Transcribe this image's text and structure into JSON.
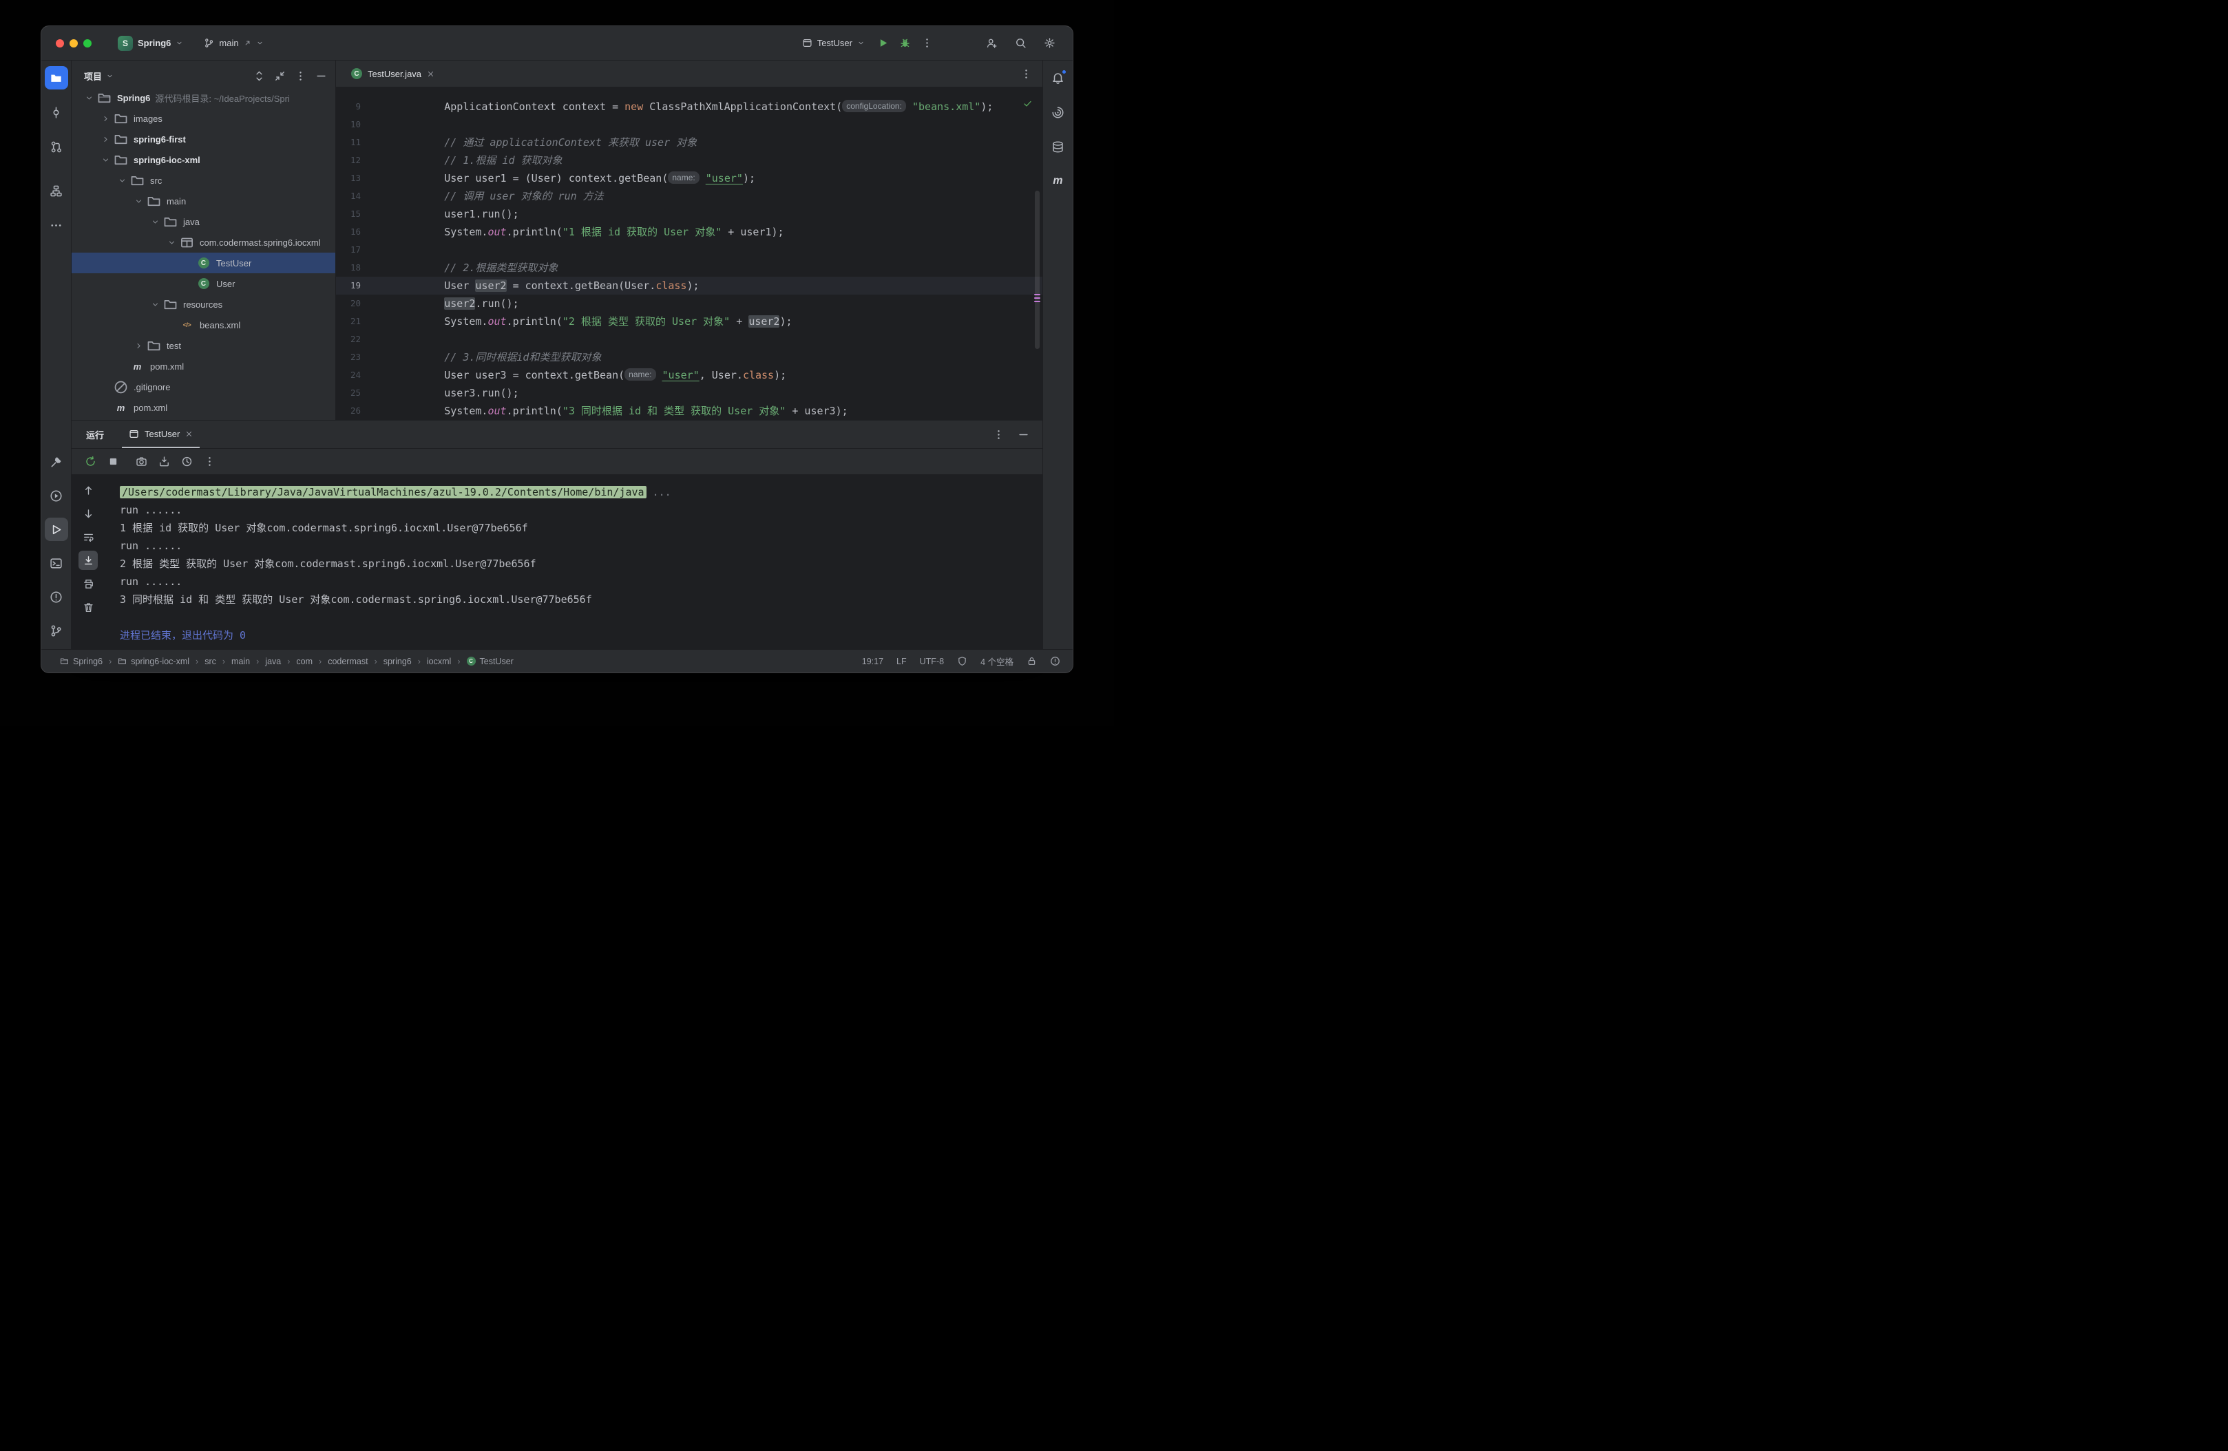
{
  "titlebar": {
    "project_initial": "S",
    "project_name": "Spring6",
    "branch": "main",
    "run_config": "TestUser",
    "run_actions": [
      {
        "icon": "run",
        "tint": "green"
      },
      {
        "icon": "debug",
        "tint": "green"
      },
      {
        "icon": "more-vertical"
      }
    ],
    "right_actions": [
      {
        "icon": "add-user"
      },
      {
        "icon": "search"
      },
      {
        "icon": "settings"
      }
    ]
  },
  "left_stripe": {
    "top": [
      {
        "icon": "project",
        "active": "blue"
      },
      {
        "icon": "commit"
      },
      {
        "icon": "pull-requests"
      },
      {
        "icon": "structure"
      },
      {
        "icon": "more-horizontal"
      }
    ],
    "bottom": [
      {
        "icon": "build"
      },
      {
        "icon": "services"
      },
      {
        "icon": "run-window",
        "active": "gray"
      },
      {
        "icon": "terminal"
      },
      {
        "icon": "problems"
      },
      {
        "icon": "git-branch"
      }
    ]
  },
  "right_stripe": {
    "top": [
      {
        "icon": "notifications",
        "badge": true
      },
      {
        "icon": "ai-assistant"
      },
      {
        "icon": "database"
      },
      {
        "icon": "maven"
      }
    ]
  },
  "project_panel": {
    "title": "项目",
    "header_icons": [
      {
        "icon": "unfold"
      },
      {
        "icon": "collapse-all"
      },
      {
        "icon": "more-vertical"
      },
      {
        "icon": "hide"
      }
    ],
    "tree": [
      {
        "indent": 0,
        "chevron": "expanded",
        "icon": "module",
        "label": "Spring6",
        "hint": "源代码根目录: ~/IdeaProjects/Spri",
        "bold": true
      },
      {
        "indent": 1,
        "chevron": "collapsed",
        "icon": "folder",
        "label": "images"
      },
      {
        "indent": 1,
        "chevron": "collapsed",
        "icon": "folder",
        "label": "spring6-first",
        "bold": true
      },
      {
        "indent": 1,
        "chevron": "expanded",
        "icon": "folder",
        "label": "spring6-ioc-xml",
        "bold": true
      },
      {
        "indent": 2,
        "chevron": "expanded",
        "icon": "folder",
        "label": "src"
      },
      {
        "indent": 3,
        "chevron": "expanded",
        "icon": "folder",
        "label": "main"
      },
      {
        "indent": 4,
        "chevron": "expanded",
        "icon": "folder",
        "label": "java"
      },
      {
        "indent": 5,
        "chevron": "expanded",
        "icon": "package",
        "label": "com.codermast.spring6.iocxml"
      },
      {
        "indent": 6,
        "chevron": null,
        "icon": "class",
        "label": "TestUser",
        "selected": true
      },
      {
        "indent": 6,
        "chevron": null,
        "icon": "class",
        "label": "User"
      },
      {
        "indent": 4,
        "chevron": "expanded",
        "icon": "folder",
        "label": "resources"
      },
      {
        "indent": 5,
        "chevron": null,
        "icon": "xml",
        "label": "beans.xml"
      },
      {
        "indent": 3,
        "chevron": "collapsed",
        "icon": "folder",
        "label": "test"
      },
      {
        "indent": 2,
        "chevron": null,
        "icon": "maven",
        "label": "pom.xml"
      },
      {
        "indent": 1,
        "chevron": null,
        "icon": "gitignore",
        "label": ".gitignore"
      },
      {
        "indent": 1,
        "chevron": null,
        "icon": "maven",
        "label": "pom.xml"
      }
    ]
  },
  "editor": {
    "tab": "TestUser.java",
    "lines": [
      {
        "num": 9,
        "segs": [
          {
            "t": "        ApplicationContext context = ",
            "c": "def"
          },
          {
            "t": "new",
            "c": "kw"
          },
          {
            "t": " ClassPathXmlApplicationContext(",
            "c": "def"
          },
          {
            "t": "configLocation:",
            "c": "hint"
          },
          {
            "t": " ",
            "c": "def"
          },
          {
            "t": "\"beans.xml\"",
            "c": "str"
          },
          {
            "t": ");",
            "c": "def"
          }
        ]
      },
      {
        "num": 10,
        "segs": []
      },
      {
        "num": 11,
        "segs": [
          {
            "t": "        ",
            "c": "def"
          },
          {
            "t": "// 通过 applicationContext 来获取 user 对象",
            "c": "cmt"
          }
        ]
      },
      {
        "num": 12,
        "segs": [
          {
            "t": "        ",
            "c": "def"
          },
          {
            "t": "// 1.根据 id 获取对象",
            "c": "cmt"
          }
        ]
      },
      {
        "num": 13,
        "segs": [
          {
            "t": "        User user1 = (User) context.getBean(",
            "c": "def"
          },
          {
            "t": "name:",
            "c": "hint"
          },
          {
            "t": " ",
            "c": "def"
          },
          {
            "t": "\"user\"",
            "c": "strref"
          },
          {
            "t": ");",
            "c": "def"
          }
        ]
      },
      {
        "num": 14,
        "segs": [
          {
            "t": "        ",
            "c": "def"
          },
          {
            "t": "// 调用 user 对象的 run 方法",
            "c": "cmt"
          }
        ]
      },
      {
        "num": 15,
        "segs": [
          {
            "t": "        user1.run();",
            "c": "def"
          }
        ]
      },
      {
        "num": 16,
        "segs": [
          {
            "t": "        System.",
            "c": "def"
          },
          {
            "t": "out",
            "c": "field"
          },
          {
            "t": ".println(",
            "c": "def"
          },
          {
            "t": "\"1 根据 id 获取的 User 对象\"",
            "c": "str"
          },
          {
            "t": " + user1);",
            "c": "def"
          }
        ]
      },
      {
        "num": 17,
        "segs": []
      },
      {
        "num": 18,
        "segs": [
          {
            "t": "        ",
            "c": "def"
          },
          {
            "t": "// 2.根据类型获取对象",
            "c": "cmt"
          }
        ]
      },
      {
        "num": 19,
        "current": true,
        "segs": [
          {
            "t": "        User ",
            "c": "def"
          },
          {
            "t": "user2",
            "c": "hl"
          },
          {
            "t": " = context.getBean(User.",
            "c": "def"
          },
          {
            "t": "class",
            "c": "kw"
          },
          {
            "t": ");",
            "c": "def"
          }
        ]
      },
      {
        "num": 20,
        "segs": [
          {
            "t": "        ",
            "c": "def"
          },
          {
            "t": "user2",
            "c": "hl"
          },
          {
            "t": ".run();",
            "c": "def"
          }
        ]
      },
      {
        "num": 21,
        "segs": [
          {
            "t": "        System.",
            "c": "def"
          },
          {
            "t": "out",
            "c": "field"
          },
          {
            "t": ".println(",
            "c": "def"
          },
          {
            "t": "\"2 根据 类型 获取的 User 对象\"",
            "c": "str"
          },
          {
            "t": " + ",
            "c": "def"
          },
          {
            "t": "user2",
            "c": "hl"
          },
          {
            "t": ");",
            "c": "def"
          }
        ]
      },
      {
        "num": 22,
        "segs": []
      },
      {
        "num": 23,
        "segs": [
          {
            "t": "        ",
            "c": "def"
          },
          {
            "t": "// 3.同时根据id和类型获取对象",
            "c": "cmt"
          }
        ]
      },
      {
        "num": 24,
        "segs": [
          {
            "t": "        User user3 = context.getBean(",
            "c": "def"
          },
          {
            "t": "name:",
            "c": "hint"
          },
          {
            "t": " ",
            "c": "def"
          },
          {
            "t": "\"user\"",
            "c": "strref"
          },
          {
            "t": ", User.",
            "c": "def"
          },
          {
            "t": "class",
            "c": "kw"
          },
          {
            "t": ");",
            "c": "def"
          }
        ]
      },
      {
        "num": 25,
        "segs": [
          {
            "t": "        user3.run();",
            "c": "def"
          }
        ]
      },
      {
        "num": 26,
        "segs": [
          {
            "t": "        System.",
            "c": "def"
          },
          {
            "t": "out",
            "c": "field"
          },
          {
            "t": ".println(",
            "c": "def"
          },
          {
            "t": "\"3 同时根据 id 和 类型 获取的 User 对象\"",
            "c": "str"
          },
          {
            "t": " + user3);",
            "c": "def"
          }
        ]
      }
    ]
  },
  "run_panel": {
    "title": "运行",
    "tab": "TestUser",
    "toolbar": [
      {
        "icon": "rerun",
        "tint": "green"
      },
      {
        "icon": "stop"
      },
      {
        "icon": "camera"
      },
      {
        "icon": "import"
      },
      {
        "icon": "history"
      },
      {
        "icon": "more-vertical"
      }
    ],
    "console_toolbar": [
      {
        "icon": "arrow-up"
      },
      {
        "icon": "arrow-down"
      },
      {
        "icon": "soft-wrap"
      },
      {
        "icon": "scroll-end",
        "active": "gray"
      },
      {
        "icon": "print"
      },
      {
        "icon": "clear"
      }
    ],
    "console": [
      {
        "type": "command",
        "text": "/Users/codermast/Library/Java/JavaVirtualMachines/azul-19.0.2/Contents/Home/bin/java",
        "suffix": " ..."
      },
      {
        "type": "plain",
        "text": "run ......"
      },
      {
        "type": "plain",
        "text": "1 根据 id 获取的 User 对象com.codermast.spring6.iocxml.User@77be656f"
      },
      {
        "type": "plain",
        "text": "run ......"
      },
      {
        "type": "plain",
        "text": "2 根据 类型 获取的 User 对象com.codermast.spring6.iocxml.User@77be656f"
      },
      {
        "type": "plain",
        "text": "run ......"
      },
      {
        "type": "plain",
        "text": "3 同时根据 id 和 类型 获取的 User 对象com.codermast.spring6.iocxml.User@77be656f"
      },
      {
        "type": "blank",
        "text": ""
      },
      {
        "type": "exit",
        "text": "进程已结束，退出代码为 0"
      }
    ]
  },
  "status_bar": {
    "breadcrumbs": [
      {
        "icon": "module",
        "label": "Spring6"
      },
      {
        "icon": "module",
        "label": "spring6-ioc-xml"
      },
      {
        "label": "src"
      },
      {
        "label": "main"
      },
      {
        "label": "java"
      },
      {
        "label": "com"
      },
      {
        "label": "codermast"
      },
      {
        "label": "spring6"
      },
      {
        "label": "iocxml"
      },
      {
        "icon": "class",
        "label": "TestUser"
      }
    ],
    "right_items": [
      {
        "name": "caret-position",
        "text": "19:17"
      },
      {
        "name": "line-separator",
        "text": "LF"
      },
      {
        "name": "file-encoding",
        "text": "UTF-8"
      },
      {
        "name": "status-widget",
        "icon": "shield"
      },
      {
        "name": "indent-style",
        "text": "4 个空格"
      },
      {
        "name": "readonly-lock",
        "icon": "lock"
      },
      {
        "name": "notifications-status",
        "icon": "error-circle"
      }
    ]
  }
}
